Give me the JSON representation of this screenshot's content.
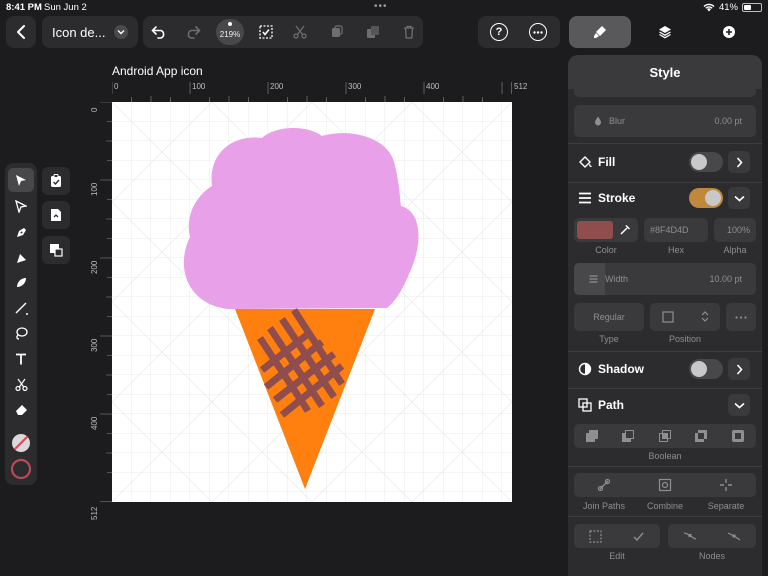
{
  "status_bar": {
    "time": "8:41 PM",
    "date": "Sun Jun 2",
    "battery": "41%",
    "battery_level": 0.41
  },
  "toolbar": {
    "document_title": "Icon de...",
    "zoom": "219%",
    "icons": [
      "back-icon",
      "chevron-down-icon",
      "undo-icon",
      "redo-icon",
      "select-box-icon",
      "scissors-icon",
      "copy-style-icon",
      "duplicate-icon",
      "trash-icon",
      "help-icon",
      "more-icon"
    ]
  },
  "tabs": [
    "brush-icon",
    "layers-icon",
    "plus-circle-icon"
  ],
  "canvas": {
    "artboard_title": "Android App icon",
    "ruler_top_labels": [
      "0",
      "100",
      "200",
      "300",
      "400",
      "512"
    ],
    "ruler_left_labels": [
      "0",
      "100",
      "200",
      "300",
      "400",
      "512"
    ],
    "scoop_color": "#E8A0E8",
    "cone_color": "#FF7F0F",
    "waffle_color": "#8F4D4D"
  },
  "tools": [
    "select-arrow-icon",
    "node-arrow-icon",
    "pen-icon",
    "vector-brush-icon",
    "pencil-icon",
    "line-icon",
    "lasso-icon",
    "text-icon",
    "scissors-icon",
    "eraser-icon"
  ],
  "side_buttons": [
    "clipboard-icon",
    "paste-icon",
    "transform-icon"
  ],
  "panel": {
    "title": "Style",
    "blur": {
      "label": "Blur",
      "value": "0.00 pt"
    },
    "fill": {
      "label": "Fill",
      "enabled": false
    },
    "stroke": {
      "label": "Stroke",
      "enabled": true,
      "color": "#8F4D4D",
      "hex": "#8F4D4D",
      "alpha": "100%",
      "color_caption": "Color",
      "hex_caption": "Hex",
      "alpha_caption": "Alpha",
      "width_label": "Width",
      "width_value": "10.00 pt",
      "type_value": "Regular",
      "type_caption": "Type",
      "position_caption": "Position",
      "toggle_color": "#C0883A"
    },
    "shadow": {
      "label": "Shadow",
      "enabled": false
    },
    "path": {
      "label": "Path",
      "boolean_caption": "Boolean",
      "join_paths": "Join Paths",
      "combine": "Combine",
      "separate": "Separate",
      "edit_caption": "Edit",
      "nodes_caption": "Nodes"
    }
  }
}
